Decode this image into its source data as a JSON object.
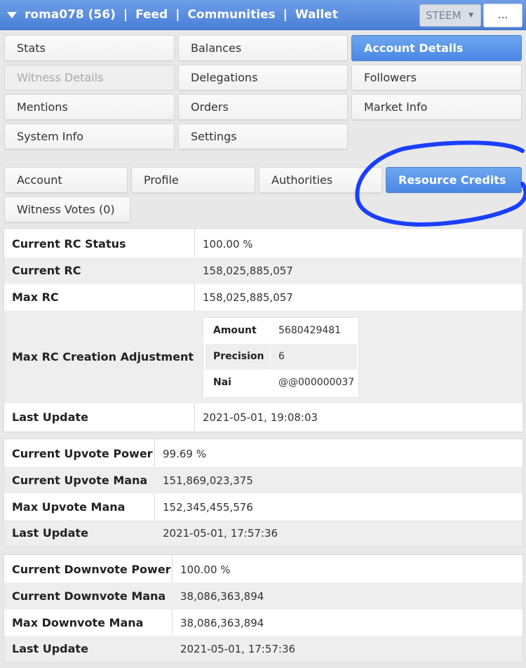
{
  "header": {
    "user": "roma078 (56)",
    "nav": [
      "Feed",
      "Communities",
      "Wallet"
    ],
    "separator": "|",
    "chain_select": "STEEM",
    "more_label": "..."
  },
  "menu": [
    {
      "label": "Stats"
    },
    {
      "label": "Balances"
    },
    {
      "label": "Account Details",
      "active": true
    },
    {
      "label": "Witness Details",
      "disabled": true
    },
    {
      "label": "Delegations"
    },
    {
      "label": "Followers"
    },
    {
      "label": "Mentions"
    },
    {
      "label": "Orders"
    },
    {
      "label": "Market Info"
    },
    {
      "label": "System Info"
    },
    {
      "label": "Settings"
    }
  ],
  "subtabs": [
    {
      "label": "Account"
    },
    {
      "label": "Profile"
    },
    {
      "label": "Authorities"
    },
    {
      "label": "Resource Credits",
      "active": true
    },
    {
      "label": "Witness Votes (0)"
    }
  ],
  "annotation_color": "#1a3fff",
  "rc": {
    "rows": [
      {
        "key": "Current RC Status",
        "value": "100.00 %"
      },
      {
        "key": "Current RC",
        "value": "158,025,885,057"
      },
      {
        "key": "Max RC",
        "value": "158,025,885,057"
      },
      {
        "key": "Max RC Creation Adjustment",
        "value": ""
      },
      {
        "key": "Last Update",
        "value": "2021-05-01, 19:08:03"
      }
    ],
    "adjustment": [
      {
        "key": "Amount",
        "value": "5680429481"
      },
      {
        "key": "Precision",
        "value": "6"
      },
      {
        "key": "Nai",
        "value": "@@000000037"
      }
    ]
  },
  "upvote": {
    "rows": [
      {
        "key": "Current Upvote Power",
        "value": "99.69 %"
      },
      {
        "key": "Current Upvote Mana",
        "value": "151,869,023,375"
      },
      {
        "key": "Max Upvote Mana",
        "value": "152,345,455,576"
      },
      {
        "key": "Last Update",
        "value": "2021-05-01, 17:57:36"
      }
    ]
  },
  "downvote": {
    "rows": [
      {
        "key": "Current Downvote Power",
        "value": "100.00 %"
      },
      {
        "key": "Current Downvote Mana",
        "value": "38,086,363,894"
      },
      {
        "key": "Max Downvote Mana",
        "value": "38,086,363,894"
      },
      {
        "key": "Last Update",
        "value": "2021-05-01, 17:57:36"
      }
    ]
  }
}
